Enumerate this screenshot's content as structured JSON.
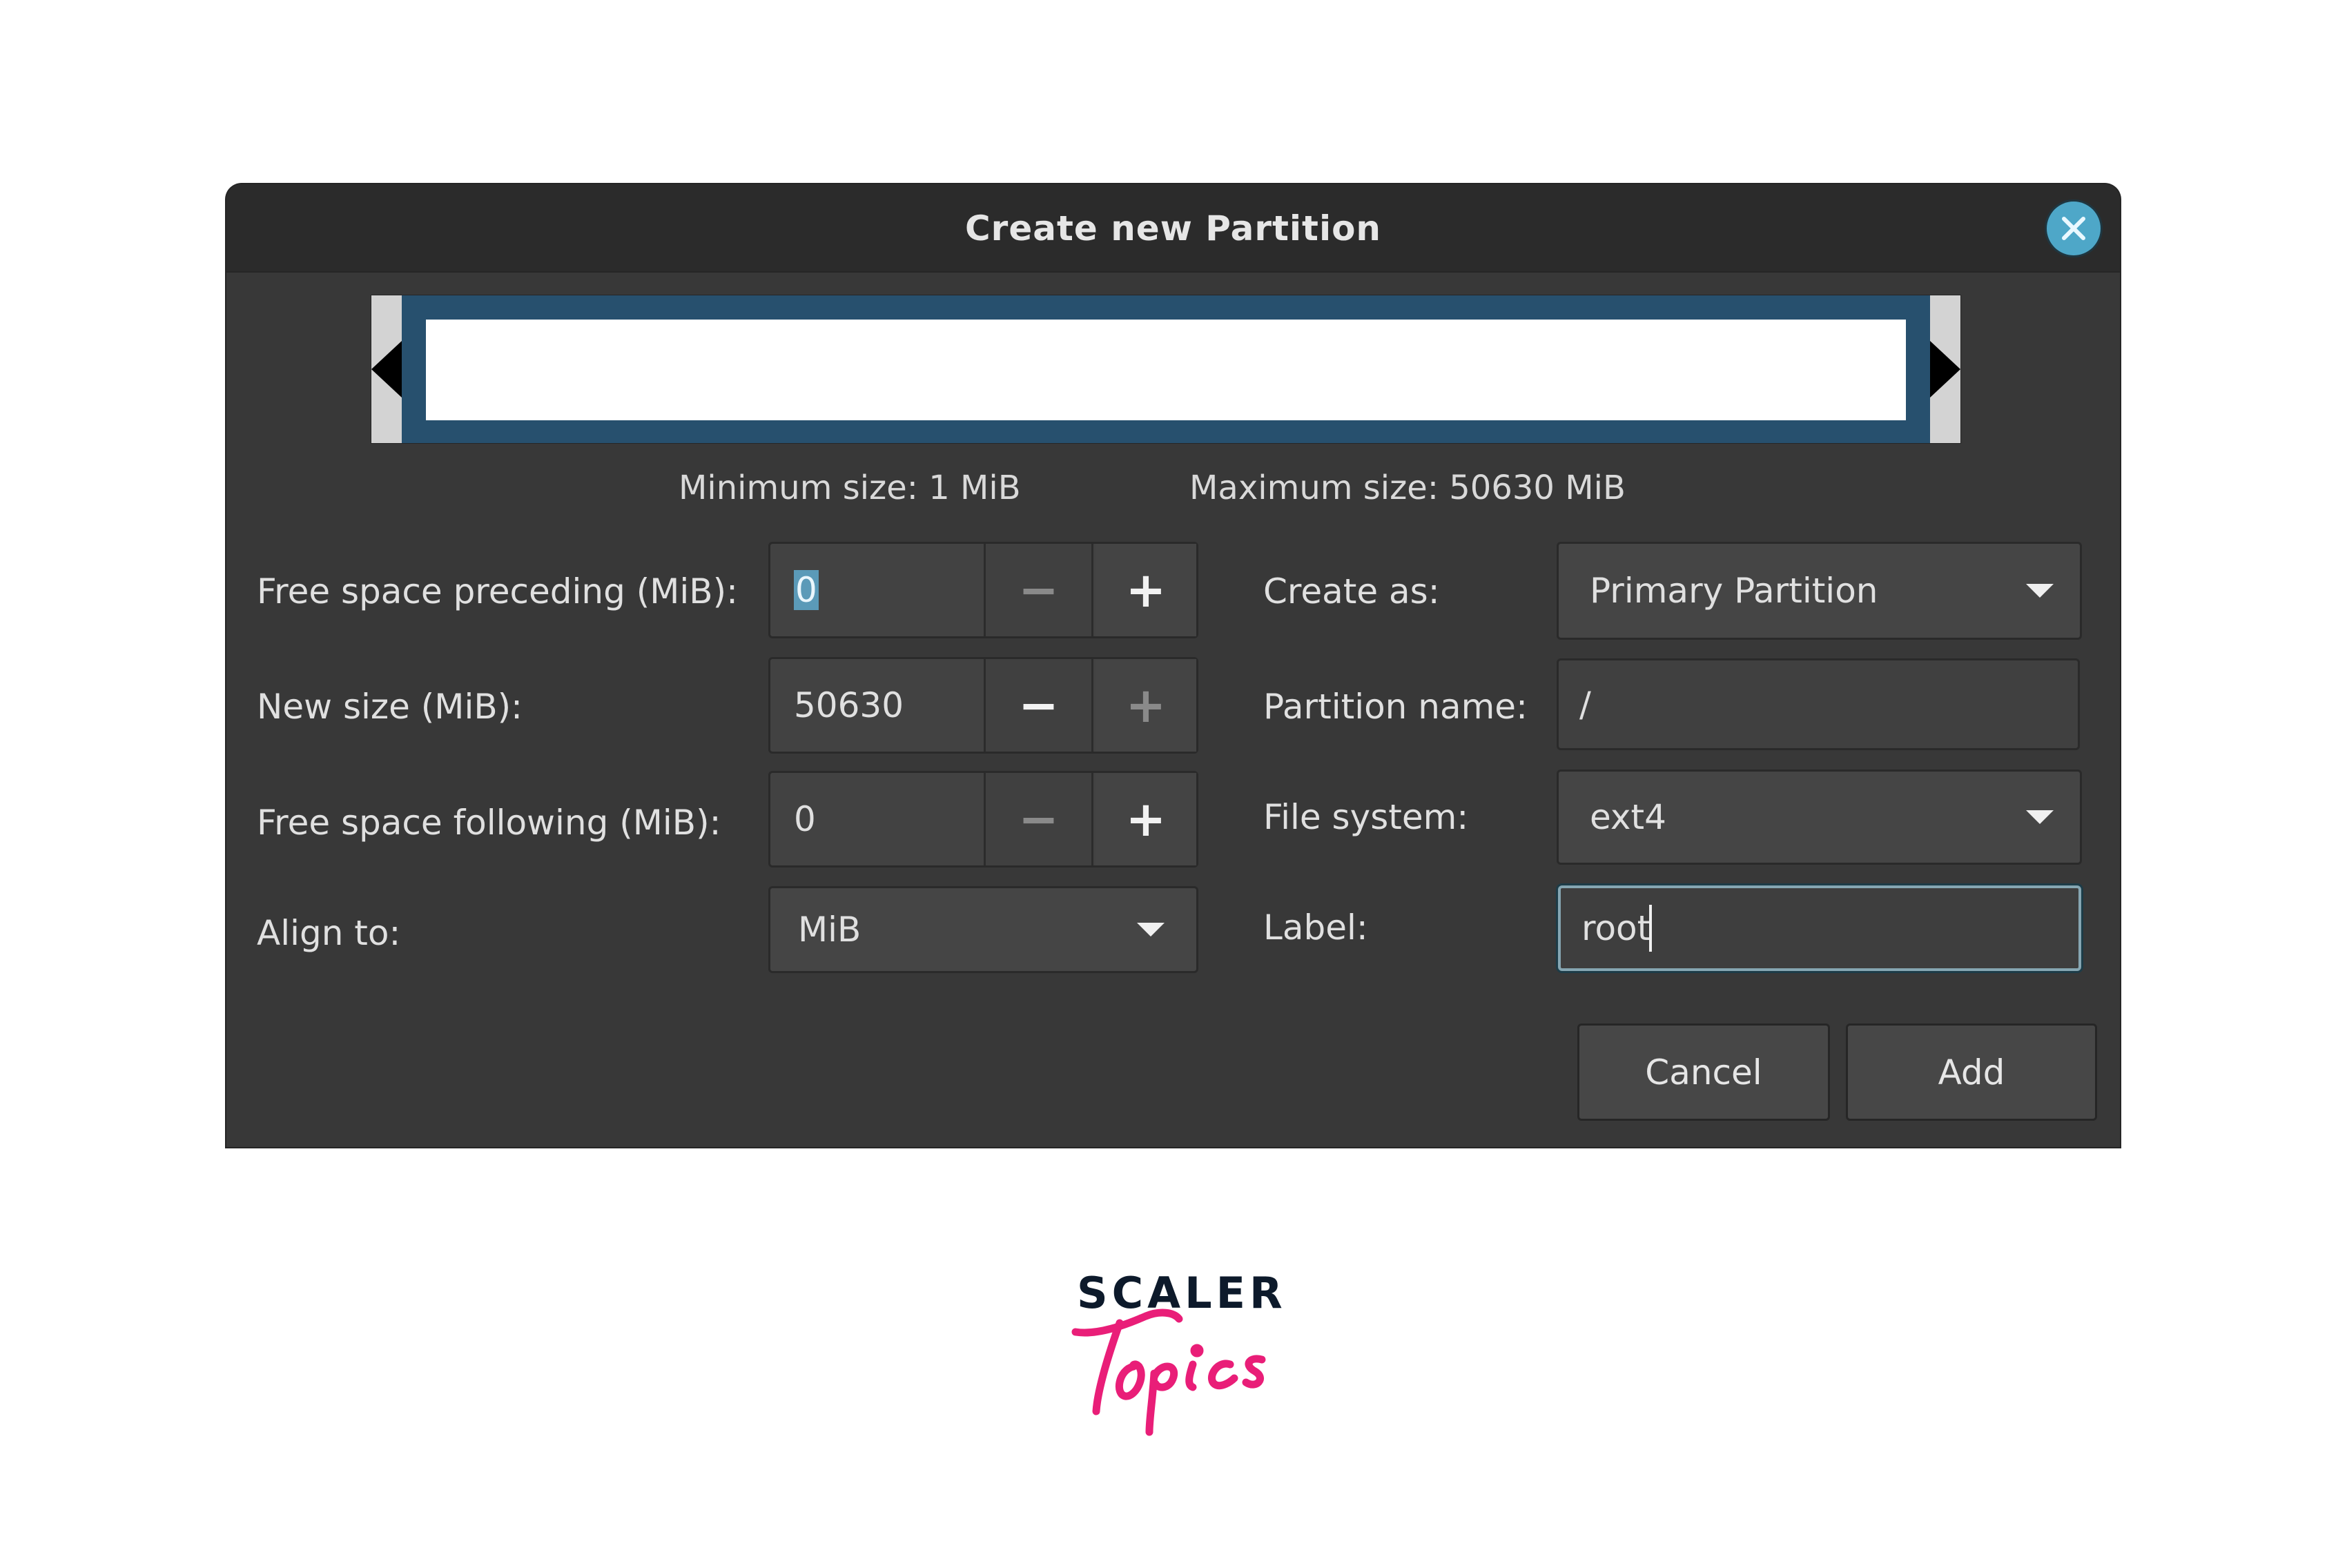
{
  "dialog": {
    "title": "Create new Partition",
    "close_icon": "close-icon",
    "close_color": "#4ea7c8"
  },
  "partition_bar": {
    "fill_fraction": 1.0,
    "partition_color": "#27506e",
    "handles": [
      "resize-left-handle",
      "resize-right-handle"
    ]
  },
  "size_info": {
    "minimum": "Minimum size: 1 MiB",
    "maximum": "Maximum size: 50630 MiB"
  },
  "left_form": {
    "free_preceding": {
      "label": "Free space preceding (MiB):",
      "value": "0",
      "selected": true,
      "minus": "−",
      "plus": "+",
      "minus_enabled": false,
      "plus_enabled": true
    },
    "new_size": {
      "label": "New size (MiB):",
      "value": "50630",
      "minus": "−",
      "plus": "+",
      "minus_enabled": true,
      "plus_enabled": false
    },
    "free_following": {
      "label": "Free space following (MiB):",
      "value": "0",
      "minus": "−",
      "plus": "+",
      "minus_enabled": false,
      "plus_enabled": true
    },
    "align_to": {
      "label": "Align to:",
      "value": "MiB"
    }
  },
  "right_form": {
    "create_as": {
      "label": "Create as:",
      "value": "Primary Partition"
    },
    "partition_name": {
      "label": "Partition name:",
      "value": "/"
    },
    "file_system": {
      "label": "File system:",
      "value": "ext4"
    },
    "fs_label": {
      "label": "Label:",
      "value": "root",
      "focused": true
    }
  },
  "buttons": {
    "cancel": "Cancel",
    "add": "Add"
  },
  "branding": {
    "line1": "SCALER",
    "line2": "Topics",
    "line1_color": "#0d1a2b",
    "line2_color": "#e91e78"
  }
}
